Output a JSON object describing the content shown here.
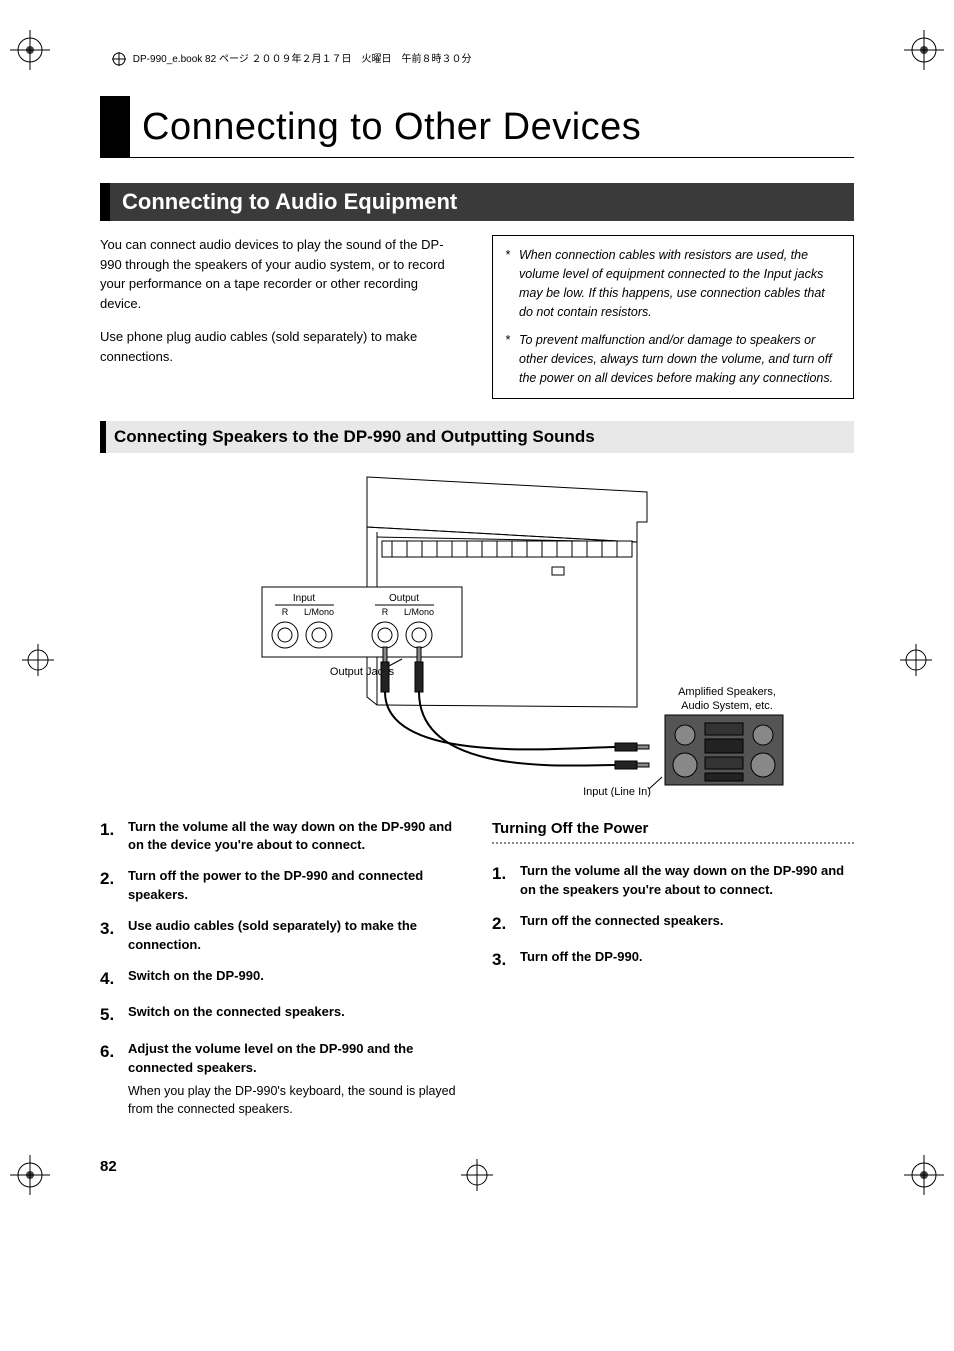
{
  "header_line": "DP-990_e.book  82 ページ  ２００９年２月１７日　火曜日　午前８時３０分",
  "chapter_title": "Connecting to Other Devices",
  "section_title": "Connecting to Audio Equipment",
  "intro_p1": "You can connect audio devices to play the sound of the DP-990 through the speakers of your audio system, or to record your performance on a tape recorder or other recording device.",
  "intro_p2": "Use phone plug audio cables (sold separately) to make connections.",
  "note1": "When connection cables with resistors are used, the volume level of equipment connected to the Input jacks may be low. If this happens, use connection cables that do not contain resistors.",
  "note2": "To prevent malfunction and/or damage to speakers or other devices, always turn down the volume, and turn off the power on all devices before making any connections.",
  "subsection_title": "Connecting Speakers to the DP-990 and Outputting Sounds",
  "diagram": {
    "input_label": "Input",
    "output_label": "Output",
    "r_label": "R",
    "lmono_label": "L/Mono",
    "output_jacks": "Output Jacks",
    "line_in": "Input (Line In)",
    "speakers_line1": "Amplified Speakers,",
    "speakers_line2": "Audio System, etc."
  },
  "steps_left": [
    {
      "n": "1.",
      "t": "Turn the volume all the way down on the DP-990 and on the device you're about to connect."
    },
    {
      "n": "2.",
      "t": "Turn off the power to the DP-990 and connected speakers."
    },
    {
      "n": "3.",
      "t": "Use audio cables (sold separately) to make the connection."
    },
    {
      "n": "4.",
      "t": "Switch on the DP-990."
    },
    {
      "n": "5.",
      "t": "Switch on the connected speakers."
    },
    {
      "n": "6.",
      "t": "Adjust the volume level on the DP-990 and the connected speakers.",
      "sub": "When you play the DP-990's keyboard, the sound is played from the connected speakers."
    }
  ],
  "right_heading": "Turning Off the Power",
  "steps_right": [
    {
      "n": "1.",
      "t": "Turn the volume all the way down on the DP-990 and on the speakers you're about to connect."
    },
    {
      "n": "2.",
      "t": "Turn off the connected speakers."
    },
    {
      "n": "3.",
      "t": "Turn off the DP-990."
    }
  ],
  "page_number": "82"
}
